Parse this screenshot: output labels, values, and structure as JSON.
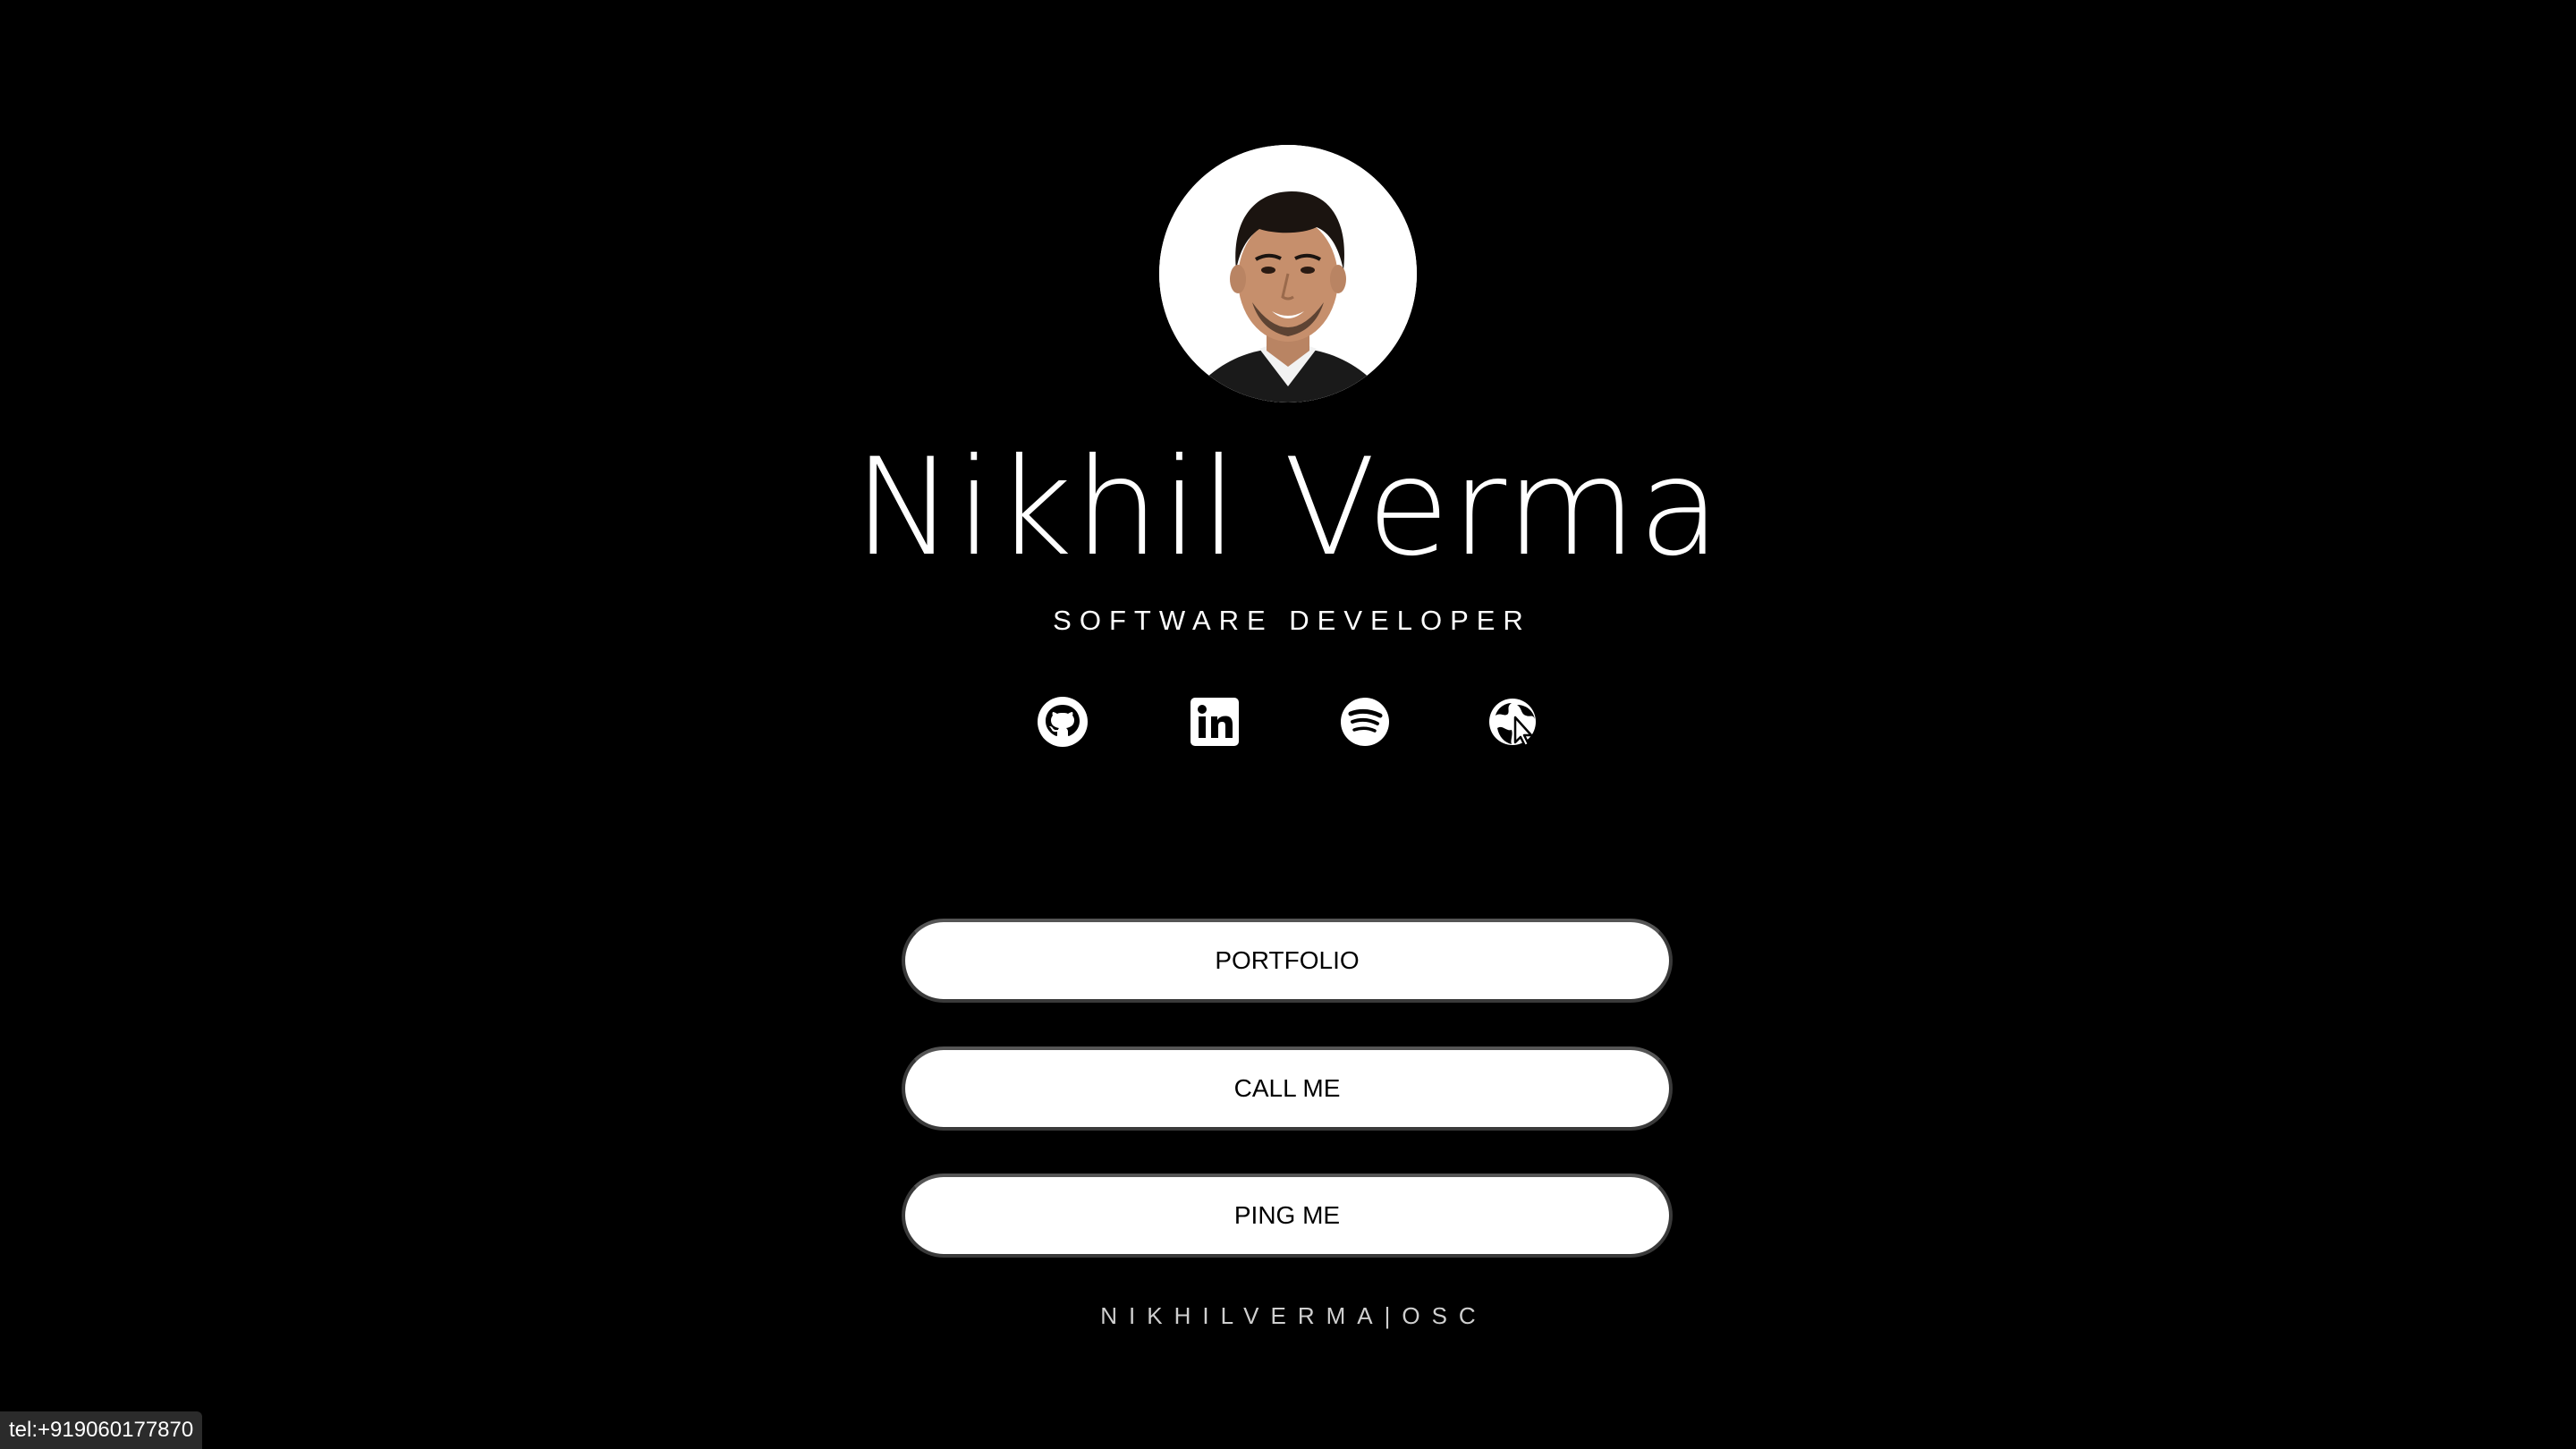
{
  "profile": {
    "name": "Nikhil Verma",
    "role": "SOFTWARE DEVELOPER",
    "avatar_alt": "profile photo"
  },
  "socials": [
    {
      "name": "github",
      "icon": "github-icon"
    },
    {
      "name": "linkedin",
      "icon": "linkedin-icon"
    },
    {
      "name": "spotify",
      "icon": "spotify-icon"
    },
    {
      "name": "website",
      "icon": "globe-icon"
    }
  ],
  "buttons": {
    "portfolio": "PORTFOLIO",
    "call": "CALL ME",
    "ping": "PING ME"
  },
  "footer": {
    "brand": "NIKHILVERMA|OSC"
  },
  "status_bar": {
    "link": "tel:+919060177870"
  },
  "colors": {
    "background": "#000000",
    "text": "#ffffff",
    "button_bg": "#ffffff",
    "button_text": "#000000"
  }
}
